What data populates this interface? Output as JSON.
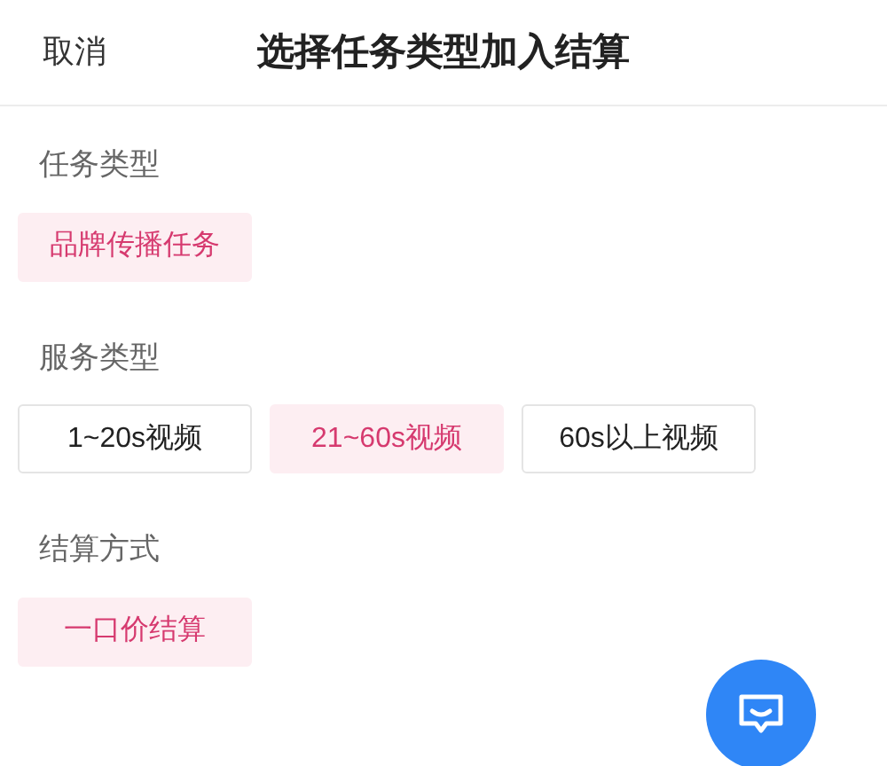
{
  "header": {
    "cancel": "取消",
    "title": "选择任务类型加入结算"
  },
  "sections": [
    {
      "label": "任务类型",
      "options": [
        {
          "label": "品牌传播任务",
          "selected": true
        }
      ]
    },
    {
      "label": "服务类型",
      "options": [
        {
          "label": "1~20s视频",
          "selected": false
        },
        {
          "label": "21~60s视频",
          "selected": true
        },
        {
          "label": "60s以上视频",
          "selected": false
        }
      ]
    },
    {
      "label": "结算方式",
      "options": [
        {
          "label": "一口价结算",
          "selected": true
        }
      ]
    }
  ]
}
